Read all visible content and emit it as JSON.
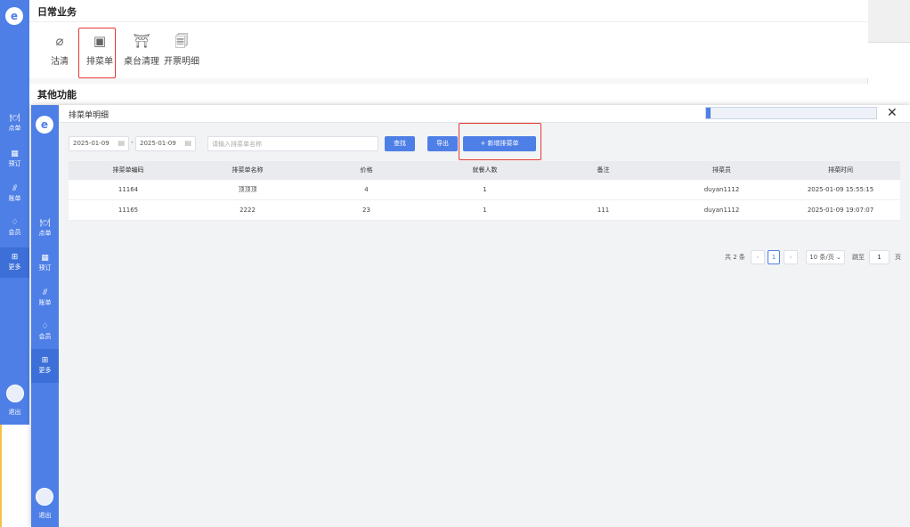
{
  "back": {
    "logo": "e",
    "section_daily": "日常业务",
    "section_other": "其他功能",
    "biz_items": [
      {
        "icon": "paperclip-icon",
        "glyph": "⌀",
        "label": "沽清"
      },
      {
        "icon": "menu-box-icon",
        "glyph": "▣",
        "label": "排菜单"
      },
      {
        "icon": "table-clean-icon",
        "glyph": "⛩",
        "label": "桌台清理"
      },
      {
        "icon": "receipt-icon",
        "glyph": "🗐",
        "label": "开票明细"
      }
    ],
    "sidebar": [
      {
        "icon": "dish-icon",
        "glyph": "🍽",
        "label": "点单"
      },
      {
        "icon": "reserve-icon",
        "glyph": "▦",
        "label": "预订"
      },
      {
        "icon": "chart-icon",
        "glyph": "⫻",
        "label": "账单"
      },
      {
        "icon": "member-icon",
        "glyph": "♢",
        "label": "会员"
      },
      {
        "icon": "grid-icon",
        "glyph": "⊞",
        "label": "更多"
      }
    ],
    "logout": "退出"
  },
  "front": {
    "title": "排菜单明细",
    "logo": "e",
    "close": "✕",
    "sidebar": [
      {
        "icon": "dish-icon",
        "glyph": "🍽",
        "label": "点单"
      },
      {
        "icon": "reserve-icon",
        "glyph": "▦",
        "label": "预订"
      },
      {
        "icon": "chart-icon",
        "glyph": "⫻",
        "label": "账单"
      },
      {
        "icon": "member-icon",
        "glyph": "♢",
        "label": "会员"
      },
      {
        "icon": "grid-icon",
        "glyph": "⊞",
        "label": "更多"
      }
    ],
    "logout": "退出",
    "filter": {
      "start_date": "2025-01-09",
      "end_date": "2025-01-09",
      "dash": "-",
      "name_placeholder": "请输入排菜单名称",
      "search": "查找",
      "export": "导出",
      "add": "+ 新增排菜单"
    },
    "table": {
      "headers": [
        "排菜单编码",
        "排菜单名称",
        "价格",
        "就餐人数",
        "备注",
        "排菜员",
        "排菜时间"
      ],
      "rows": [
        [
          "11164",
          "顶顶顶",
          "4",
          "1",
          "",
          "duyan1112",
          "2025-01-09 15:55:15"
        ],
        [
          "11165",
          "2222",
          "23",
          "1",
          "111",
          "duyan1112",
          "2025-01-09 19:07:07"
        ]
      ]
    },
    "pager": {
      "total": "共 2 条",
      "prev": "‹",
      "page": "1",
      "next": "›",
      "page_size": "10 条/页 ⌄",
      "goto": "跳至",
      "goto_value": "1",
      "page_unit": "页"
    }
  }
}
